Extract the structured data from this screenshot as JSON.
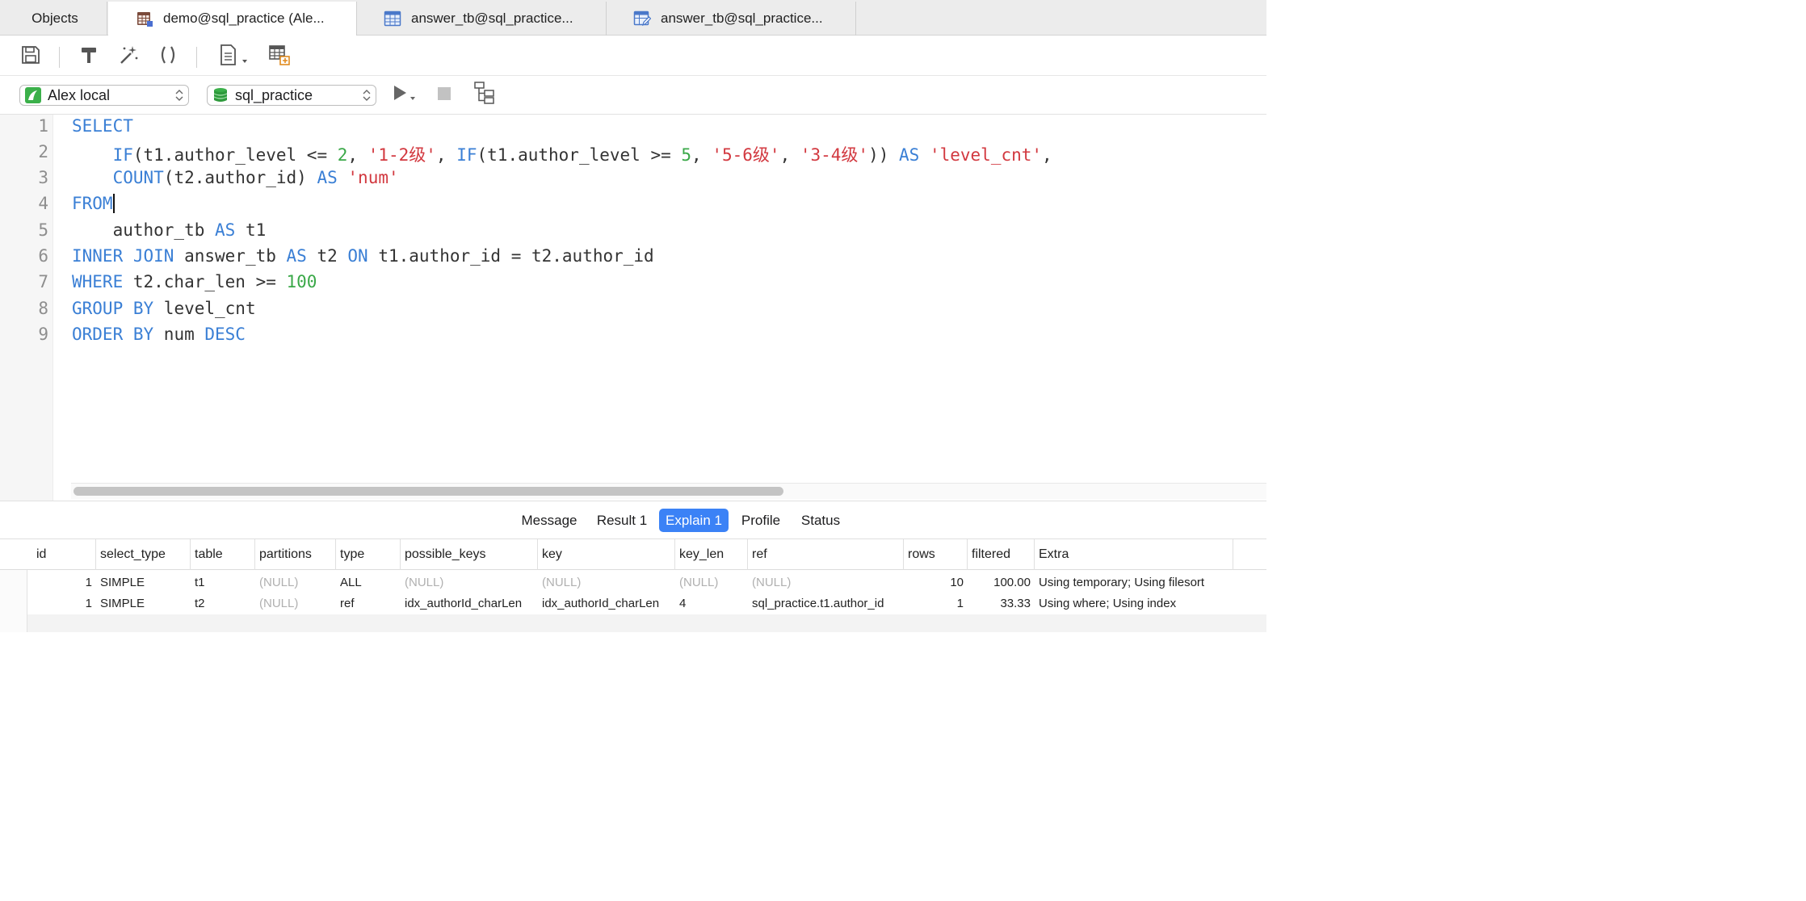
{
  "tabs": [
    {
      "label": "Objects",
      "icon": "none"
    },
    {
      "label": "demo@sql_practice (Ale...",
      "icon": "query-table-icon",
      "active": true
    },
    {
      "label": "answer_tb@sql_practice...",
      "icon": "table-icon"
    },
    {
      "label": "answer_tb@sql_practice...",
      "icon": "table-edit-icon"
    }
  ],
  "toolbar": {
    "icons": [
      "save-icon",
      "format-hammer-icon",
      "beautify-wand-icon",
      "parentheses-icon",
      "snippet-document-icon",
      "query-builder-icon"
    ]
  },
  "selectors": {
    "connection": "Alex local",
    "database": "sql_practice"
  },
  "editor": {
    "line_numbers": [
      "1",
      "2",
      "3",
      "4",
      "5",
      "6",
      "7",
      "8",
      "9"
    ],
    "line1": {
      "kw": "SELECT"
    },
    "line2": {
      "indent": "    ",
      "if1": "IF",
      "p1": "(t1.author_level <= ",
      "n1": "2",
      "c1": ", ",
      "s1": "'1-2级'",
      "c2": ", ",
      "if2": "IF",
      "p2": "(t1.author_level >= ",
      "n2": "5",
      "c3": ", ",
      "s2": "'5-6级'",
      "c4": ", ",
      "s3": "'3-4级'",
      "p3": ")) ",
      "as": "AS",
      "sp": " ",
      "s4": "'level_cnt'",
      "c5": ","
    },
    "line3": {
      "indent": "    ",
      "fn": "COUNT",
      "p1": "(t2.author_id) ",
      "as": "AS",
      "sp": " ",
      "s1": "'num'"
    },
    "line4": {
      "kw": "FROM"
    },
    "line5": {
      "indent": "    ",
      "t1": "author_tb ",
      "as": "AS",
      "t2": " t1"
    },
    "line6": {
      "kw1": "INNER JOIN",
      "t1": " answer_tb ",
      "as": "AS",
      "t2": " t2 ",
      "on": "ON",
      "t3": " t1.author_id = t2.author_id"
    },
    "line7": {
      "kw": "WHERE",
      "t1": " t2.char_len >= ",
      "n1": "100"
    },
    "line8": {
      "kw": "GROUP BY",
      "t1": " level_cnt"
    },
    "line9": {
      "kw": "ORDER BY",
      "t1": " num ",
      "kw2": "DESC"
    }
  },
  "result_tabs": [
    {
      "label": "Message"
    },
    {
      "label": "Result 1"
    },
    {
      "label": "Explain 1",
      "active": true
    },
    {
      "label": "Profile"
    },
    {
      "label": "Status"
    }
  ],
  "explain": {
    "columns": [
      "id",
      "select_type",
      "table",
      "partitions",
      "type",
      "possible_keys",
      "key",
      "key_len",
      "ref",
      "rows",
      "filtered",
      "Extra"
    ],
    "rows": [
      [
        "1",
        "SIMPLE",
        "t1",
        "(NULL)",
        "ALL",
        "(NULL)",
        "(NULL)",
        "(NULL)",
        "(NULL)",
        "10",
        "100.00",
        "Using temporary; Using filesort"
      ],
      [
        "1",
        "SIMPLE",
        "t2",
        "(NULL)",
        "ref",
        "idx_authorId_charLen",
        "idx_authorId_charLen",
        "4",
        "sql_practice.t1.author_id",
        "1",
        "33.33",
        "Using where; Using index"
      ]
    ]
  },
  "colors": {
    "keyword": "#3a7fd5",
    "string": "#d2383f",
    "number": "#3aa848",
    "active_result_tab": "#3b82f6",
    "null_text": "#b0b0b0"
  }
}
